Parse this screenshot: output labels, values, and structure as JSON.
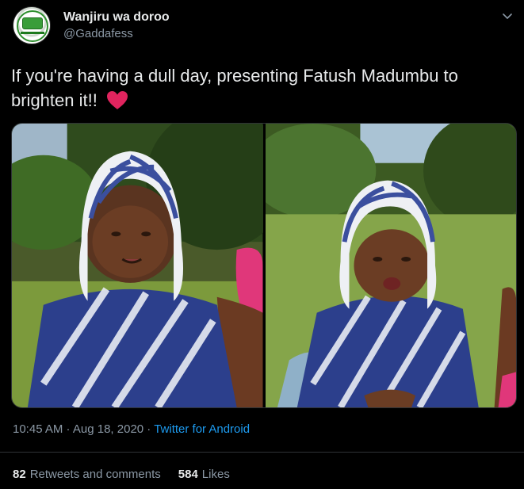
{
  "author": {
    "display_name": "Wanjiru wa doroo",
    "handle": "@Gaddafess",
    "avatar_icon": "profile-avatar"
  },
  "tweet": {
    "text": "If you're having a dull day, presenting Fatush Madumbu to brighten it!!",
    "emoji_icon": "red-heart-icon",
    "media_count": 2
  },
  "meta": {
    "timestamp": "10:45 AM · Aug 18, 2020 · ",
    "source": "Twitter for Android"
  },
  "stats": {
    "retweets_count": "82",
    "retweets_label": "Retweets and comments",
    "likes_count": "584",
    "likes_label": "Likes"
  },
  "colors": {
    "background": "#000000",
    "text_primary": "#e7e9ea",
    "text_secondary": "#8b98a5",
    "link": "#1d9bf0",
    "heart": "#e0245e"
  }
}
